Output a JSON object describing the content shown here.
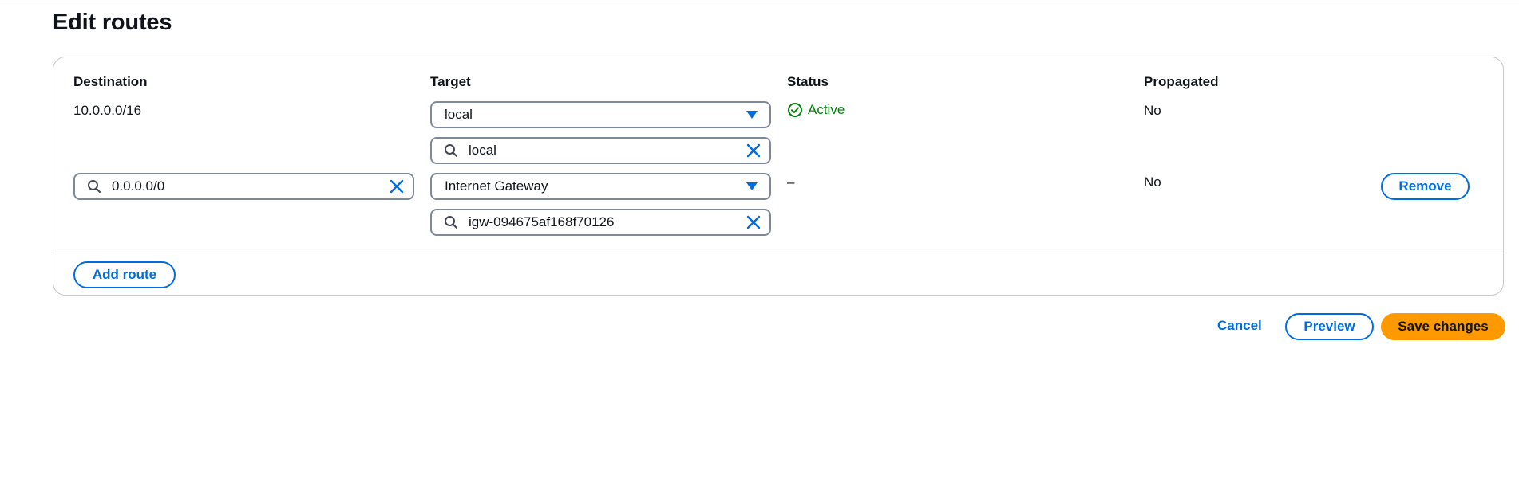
{
  "page": {
    "title": "Edit routes"
  },
  "table": {
    "headers": {
      "destination": "Destination",
      "target": "Target",
      "status": "Status",
      "propagated": "Propagated"
    },
    "rows": [
      {
        "destination": "10.0.0.0/16",
        "target_select": "local",
        "target_search": "local",
        "status": "Active",
        "propagated": "No"
      },
      {
        "destination_search": "0.0.0.0/0",
        "target_select": "Internet Gateway",
        "target_search": "igw-094675af168f70126",
        "status": "–",
        "propagated": "No",
        "remove_label": "Remove"
      }
    ],
    "add_route_label": "Add route"
  },
  "actions": {
    "cancel_label": "Cancel",
    "preview_label": "Preview",
    "save_label": "Save changes"
  },
  "colors": {
    "link": "#006ce0",
    "primary": "#ff9900",
    "success": "#037f0c"
  }
}
